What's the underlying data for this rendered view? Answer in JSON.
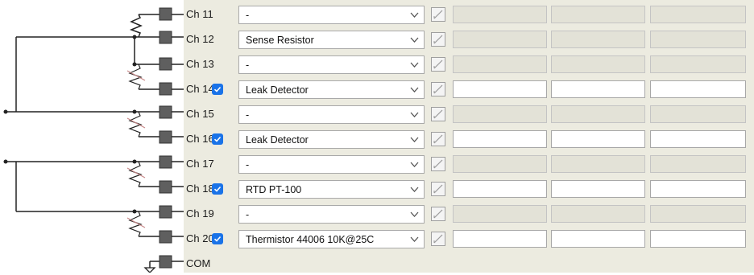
{
  "channels": [
    {
      "label": "Ch 11",
      "checked": false,
      "sensor": "-"
    },
    {
      "label": "Ch 12",
      "checked": false,
      "sensor": "Sense Resistor"
    },
    {
      "label": "Ch 13",
      "checked": false,
      "sensor": "-"
    },
    {
      "label": "Ch 14",
      "checked": true,
      "sensor": "Leak Detector"
    },
    {
      "label": "Ch 15",
      "checked": false,
      "sensor": "-"
    },
    {
      "label": "Ch 16",
      "checked": true,
      "sensor": "Leak Detector"
    },
    {
      "label": "Ch 17",
      "checked": false,
      "sensor": "-"
    },
    {
      "label": "Ch 18",
      "checked": true,
      "sensor": "RTD PT-100"
    },
    {
      "label": "Ch 19",
      "checked": false,
      "sensor": "-"
    },
    {
      "label": "Ch 20",
      "checked": true,
      "sensor": "Thermistor 44006 10K@25C"
    }
  ],
  "com_label": "COM",
  "colors": {
    "checkbox": "#1a73e8",
    "panel": "#ecebe0",
    "terminal": "#5f5f5f",
    "disabled_resistor": "#c98a8a"
  }
}
